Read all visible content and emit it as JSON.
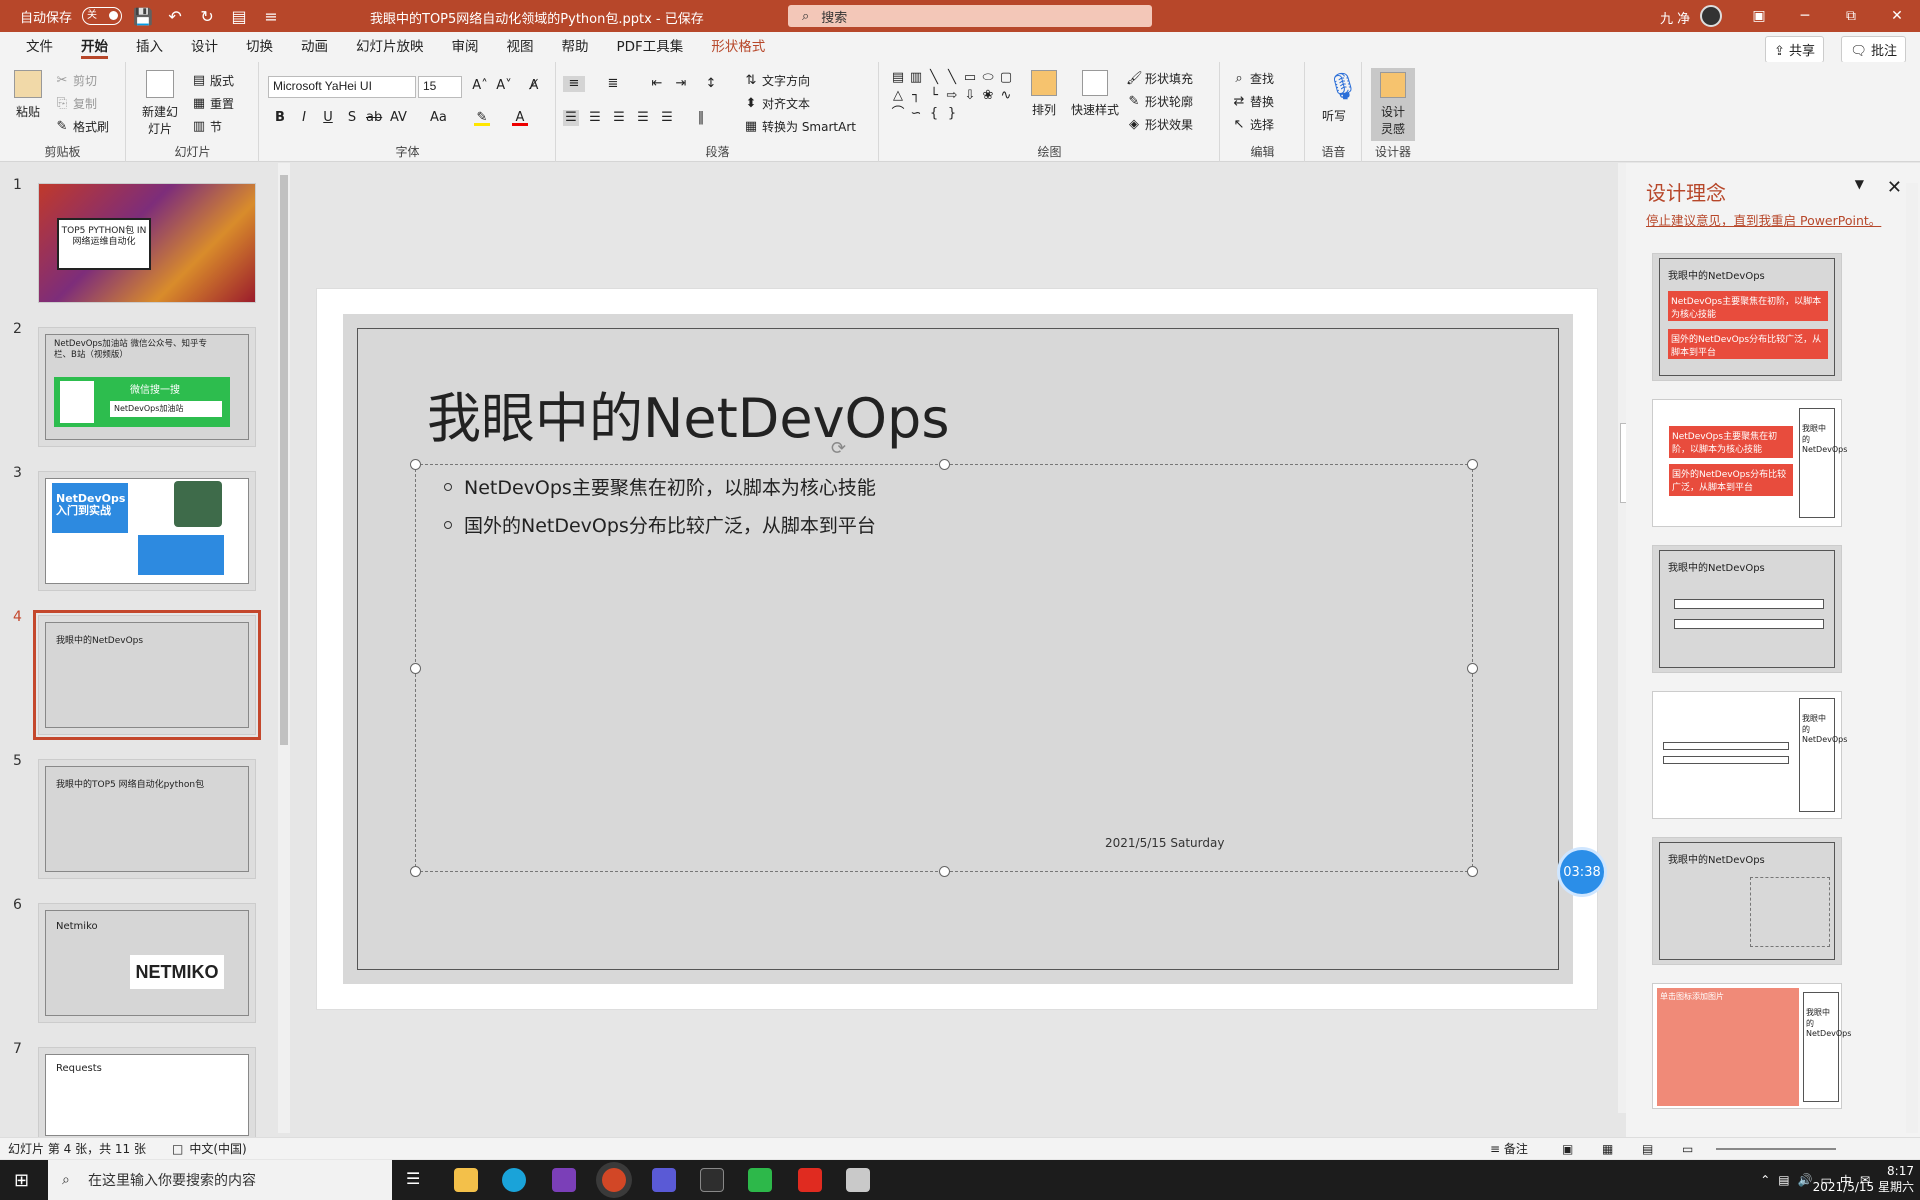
{
  "titlebar": {
    "autosave_label": "自动保存",
    "autosave_state": "关",
    "doc_title": "我眼中的TOP5网络自动化领域的Python包.pptx - 已保存",
    "search_placeholder": "搜索",
    "user_name": "九 净"
  },
  "menu": {
    "tabs": [
      "文件",
      "开始",
      "插入",
      "设计",
      "切换",
      "动画",
      "幻灯片放映",
      "审阅",
      "视图",
      "帮助",
      "PDF工具集",
      "形状格式"
    ],
    "share": "共享",
    "comment": "批注"
  },
  "ribbon": {
    "clipboard": {
      "label": "剪贴板",
      "paste": "粘贴",
      "cut": "剪切",
      "copy": "复制",
      "format_painter": "格式刷"
    },
    "slides": {
      "label": "幻灯片",
      "new_slide": "新建幻灯片",
      "layout": "版式",
      "reset": "重置",
      "section": "节"
    },
    "font": {
      "label": "字体",
      "family": "Microsoft YaHei UI",
      "size": "15"
    },
    "paragraph": {
      "label": "段落",
      "text_direction": "文字方向",
      "align_text": "对齐文本",
      "smartart": "转换为 SmartArt"
    },
    "drawing": {
      "label": "绘图",
      "arrange": "排列",
      "quick_styles": "快速样式",
      "fill": "形状填充",
      "outline": "形状轮廓",
      "effects": "形状效果"
    },
    "editing": {
      "label": "编辑",
      "find": "查找",
      "replace": "替换",
      "select": "选择"
    },
    "voice": {
      "label": "语音",
      "dictate": "听写"
    },
    "designer": {
      "label": "设计器",
      "ideas": "设计灵感"
    }
  },
  "thumbnails": [
    {
      "num": "1",
      "title": "TOP5 PYTHON包 IN 网络运维自动化"
    },
    {
      "num": "2",
      "title": "NetDevOps加油站 微信公众号、知乎专栏、B站（视频版）",
      "wechat": "微信搜一搜",
      "search": "NetDevOps加油站"
    },
    {
      "num": "3",
      "title": "NetDevOps 入门到实战"
    },
    {
      "num": "4",
      "title": "我眼中的NetDevOps"
    },
    {
      "num": "5",
      "title": "我眼中的TOP5 网络自动化python包"
    },
    {
      "num": "6",
      "title": "Netmiko",
      "logo": "NETMIKO"
    },
    {
      "num": "7",
      "title": "Requests"
    }
  ],
  "slide": {
    "title": "我眼中的NetDevOps",
    "bullets": [
      "NetDevOps主要聚焦在初阶，以脚本为核心技能",
      "国外的NetDevOps分布比较广泛，从脚本到平台"
    ],
    "date": "2021/5/15 Saturday"
  },
  "timer": "03:38",
  "design_panel": {
    "title": "设计理念",
    "link": "停止建议意见，直到我重启 PowerPoint。",
    "card_title": "我眼中的NetDevOps",
    "bullet1": "NetDevOps主要聚焦在初阶，以脚本为核心技能",
    "bullet2": "国外的NetDevOps分布比较广泛，从脚本到平台",
    "card_title_split": "我眼中的 NetDevOps",
    "placeholder_hint": "单击图标添加图片"
  },
  "status": {
    "slide_info": "幻灯片 第 4 张，共 11 张",
    "language": "中文(中国)",
    "notes": "备注",
    "zoom_icon": "fit-slide-icon"
  },
  "taskbar": {
    "search_placeholder": "在这里输入你要搜索的内容",
    "time": "8:17",
    "date": "2021/5/15 星期六",
    "ime": "中"
  },
  "colors": {
    "accent": "#b7472a",
    "selection": "#c4472c",
    "timer": "#2b8ee8"
  }
}
